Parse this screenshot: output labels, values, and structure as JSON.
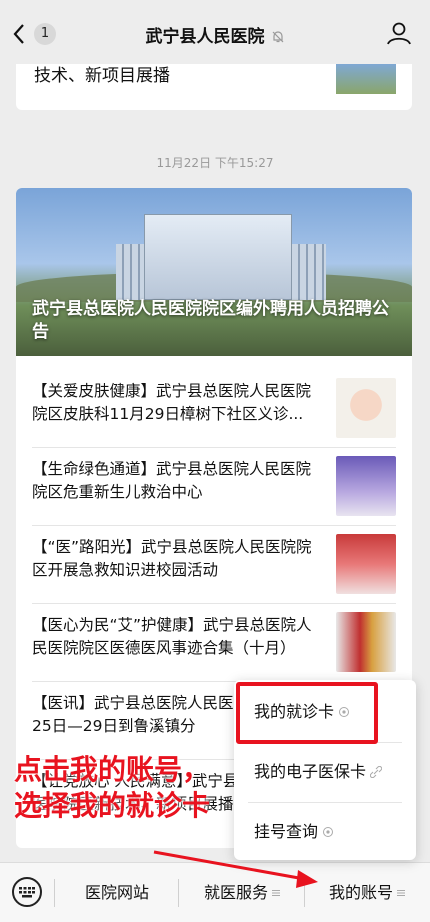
{
  "header": {
    "back_count": "1",
    "title": "武宁县人民医院"
  },
  "top_card": {
    "text": "技术、新项目展播"
  },
  "timestamp": "11月22日 下午15:27",
  "main_card": {
    "hero_caption": "武宁县总医院人民医院院区编外聘用人员招聘公告",
    "items": [
      {
        "text": "【关爱皮肤健康】武宁县总医院人民医院院区皮肤科11月29日樟树下社区义诊..."
      },
      {
        "text": "【生命绿色通道】武宁县总医院人民医院院区危重新生儿救治中心"
      },
      {
        "text": "【“医”路阳光】武宁县总医院人民医院院区开展急救知识进校园活动"
      },
      {
        "text": "【医心为民“艾”护健康】武宁县总医院人民医院院区医德医风事迹合集（十月）"
      },
      {
        "text": "【医讯】武宁县总医院人民医院院区11月25日—29日到鲁溪镇分"
      },
      {
        "text": "【让党放心 人民满意】武宁县总医院人民医院院区新技术、新项目展播"
      }
    ]
  },
  "popup_menu": {
    "items": [
      {
        "label": "我的就诊卡"
      },
      {
        "label": "我的电子医保卡"
      },
      {
        "label": "挂号查询"
      }
    ]
  },
  "annotation": {
    "line1": "点击我的账号，",
    "line2": "选择我的就诊卡"
  },
  "bottom_bar": {
    "tabs": [
      {
        "label": "医院网站"
      },
      {
        "label": "就医服务"
      },
      {
        "label": "我的账号"
      }
    ]
  },
  "colors": {
    "accent_red": "#e8131f",
    "background": "#ededed"
  }
}
